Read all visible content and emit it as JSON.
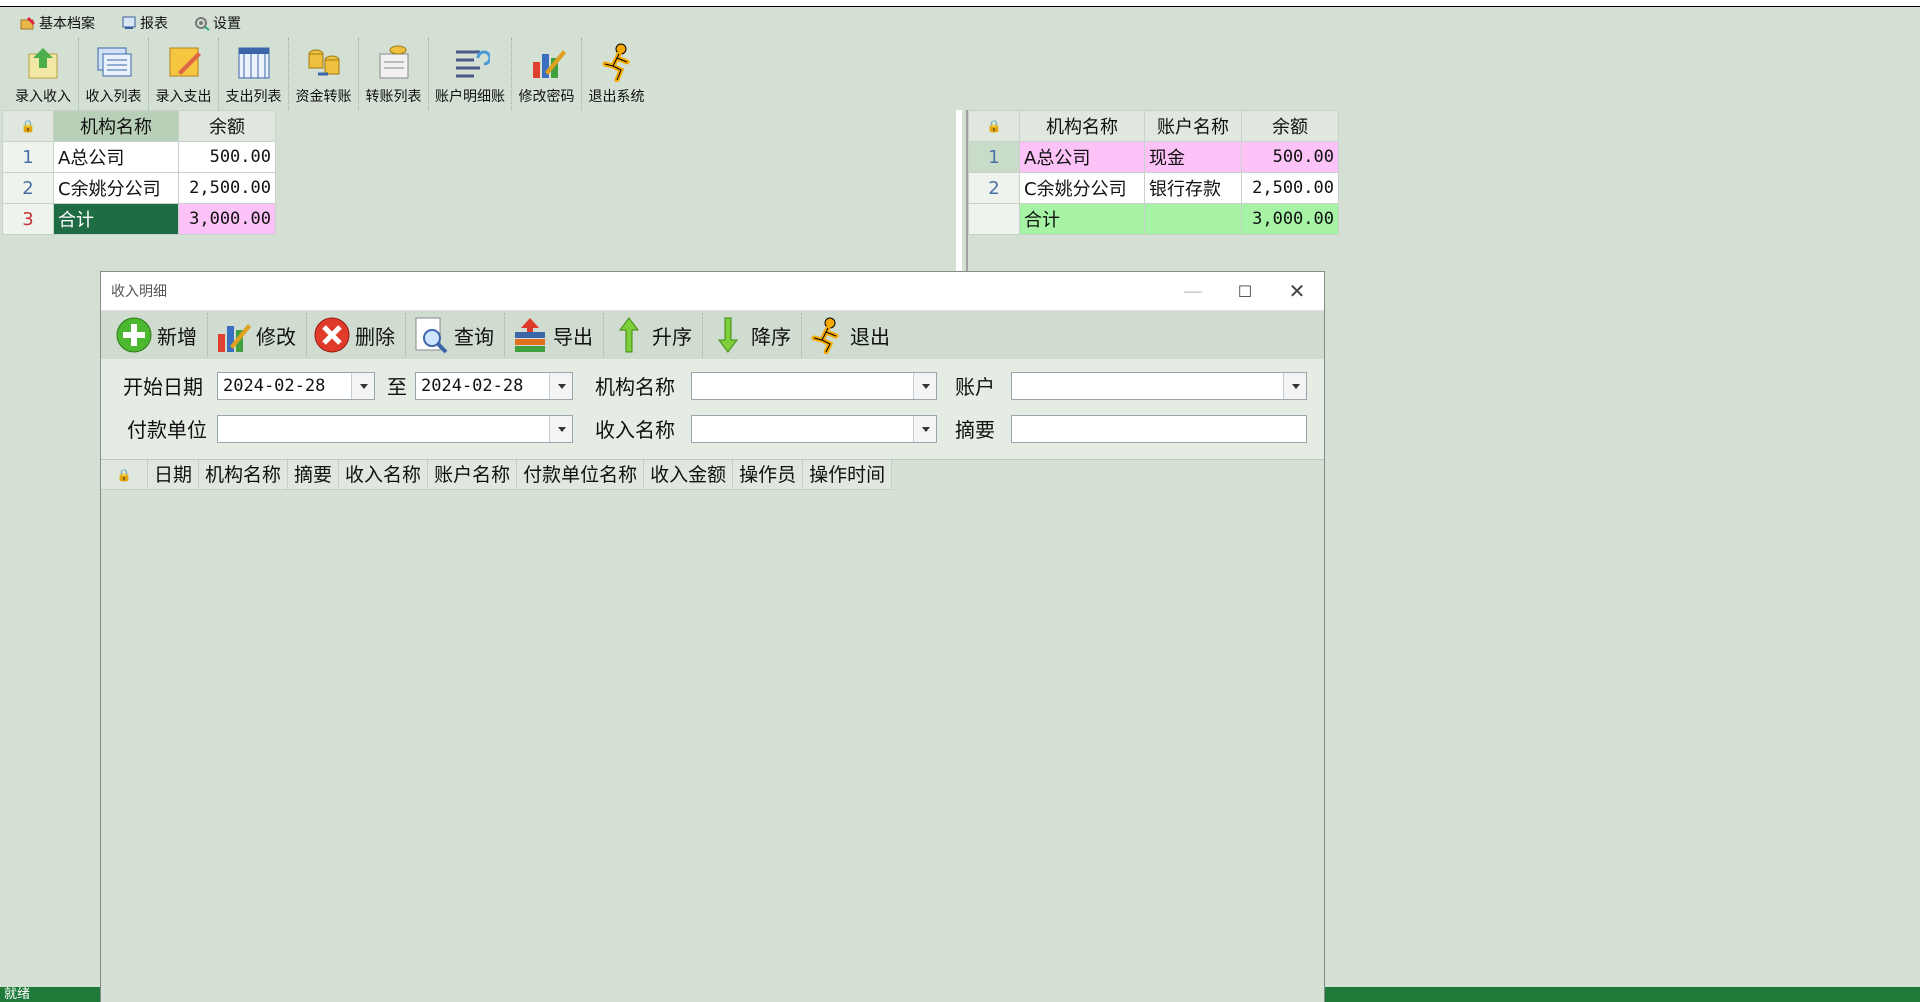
{
  "menu": [
    {
      "label": "基本档案",
      "icon": "folder-edit-icon"
    },
    {
      "label": "报表",
      "icon": "report-icon"
    },
    {
      "label": "设置",
      "icon": "settings-icon"
    }
  ],
  "toolbar": [
    {
      "label": "录入收入",
      "icon": "income-entry-icon"
    },
    {
      "label": "收入列表",
      "icon": "income-list-icon"
    },
    {
      "label": "录入支出",
      "icon": "expense-entry-icon"
    },
    {
      "label": "支出列表",
      "icon": "expense-list-icon"
    },
    {
      "label": "资金转账",
      "icon": "fund-transfer-icon"
    },
    {
      "label": "转账列表",
      "icon": "transfer-list-icon"
    },
    {
      "label": "账户明细账",
      "icon": "account-ledger-icon"
    },
    {
      "label": "修改密码",
      "icon": "change-password-icon"
    },
    {
      "label": "退出系统",
      "icon": "exit-runner-icon"
    }
  ],
  "left_table": {
    "headers": [
      "机构名称",
      "余额"
    ],
    "rows": [
      {
        "no": "1",
        "name": "A总公司",
        "balance": "500.00"
      },
      {
        "no": "2",
        "name": "C余姚分公司",
        "balance": "2,500.00"
      },
      {
        "no": "3",
        "name": "合计",
        "balance": "3,000.00"
      }
    ]
  },
  "right_table": {
    "headers": [
      "机构名称",
      "账户名称",
      "余额"
    ],
    "rows": [
      {
        "no": "1",
        "name": "A总公司",
        "account": "现金",
        "balance": "500.00"
      },
      {
        "no": "2",
        "name": "C余姚分公司",
        "account": "银行存款",
        "balance": "2,500.00"
      },
      {
        "no": "",
        "name": "合计",
        "account": "",
        "balance": "3,000.00"
      }
    ]
  },
  "dialog": {
    "title": "收入明细",
    "toolbar": [
      {
        "label": "新增",
        "icon": "add-circle-icon"
      },
      {
        "label": "修改",
        "icon": "edit-chart-icon"
      },
      {
        "label": "删除",
        "icon": "delete-circle-icon"
      },
      {
        "label": "查询",
        "icon": "search-doc-icon"
      },
      {
        "label": "导出",
        "icon": "export-icon"
      },
      {
        "label": "升序",
        "icon": "arrow-up-icon"
      },
      {
        "label": "降序",
        "icon": "arrow-down-icon"
      },
      {
        "label": "退出",
        "icon": "exit-runner-icon"
      }
    ],
    "filters": {
      "start_date_label": "开始日期",
      "start_date": "2024-02-28",
      "to_label": "至",
      "end_date": "2024-02-28",
      "org_label": "机构名称",
      "org_value": "",
      "account_label": "账户",
      "account_value": "",
      "payer_label": "付款单位",
      "payer_value": "",
      "income_name_label": "收入名称",
      "income_name_value": "",
      "summary_label": "摘要",
      "summary_value": ""
    },
    "grid_headers": [
      "日期",
      "机构名称",
      "摘要",
      "收入名称",
      "账户名称",
      "付款单位名称",
      "收入金额",
      "操作员",
      "操作时间"
    ]
  },
  "status": "就绪",
  "colors": {
    "selected_row": "#1f6b44",
    "pink": "#fdc3f8",
    "green_total": "#a6f3a6",
    "status_bar": "#1f7a3a"
  }
}
